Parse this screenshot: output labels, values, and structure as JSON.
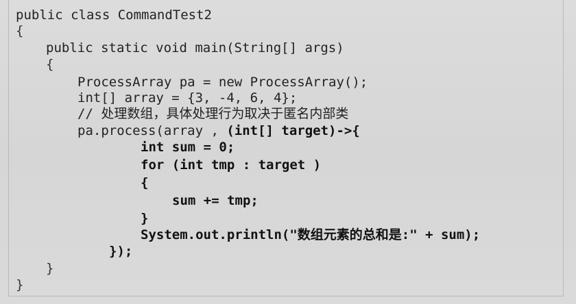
{
  "code": {
    "l1": "public class CommandTest2",
    "l2": "{",
    "l3": "public static void main(String[] args)",
    "l4": "{",
    "l5": "ProcessArray pa = new ProcessArray();",
    "l6": "int[] array = {3, -4, 6, 4};",
    "l7": "// 处理数组，具体处理行为取决于匿名内部类",
    "l8_normal": "pa.process(array , ",
    "l8_bold": "(int[] target)->{",
    "l9": "int sum = 0;",
    "l10": "for (int tmp : target )",
    "l11": "{",
    "l12": "sum += tmp;",
    "l13": "}",
    "l14": "System.out.println(\"数组元素的总和是:\" + sum);",
    "l15": "});",
    "l16": "}",
    "l17": "}"
  }
}
